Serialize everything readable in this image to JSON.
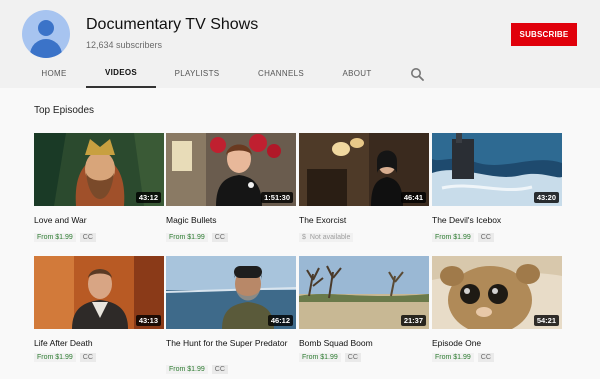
{
  "channel": {
    "name": "Documentary TV Shows",
    "subscribers": "12,634 subscribers"
  },
  "subscribe_label": "SUBSCRIBE",
  "tabs": [
    "HOME",
    "VIDEOS",
    "PLAYLISTS",
    "CHANNELS",
    "ABOUT"
  ],
  "active_tab": "VIDEOS",
  "section_title": "Top Episodes",
  "episodes": [
    {
      "title": "Love and War",
      "duration": "43:12",
      "price": "From $1.99",
      "cc": "CC"
    },
    {
      "title": "Magic Bullets",
      "duration": "1:51:30",
      "price": "From $1.99",
      "cc": "CC"
    },
    {
      "title": "The Exorcist",
      "duration": "46:41",
      "price_symbol": "$",
      "availability": "Not available"
    },
    {
      "title": "The Devil's Icebox",
      "duration": "43:20",
      "price": "From $1.99",
      "cc": "CC"
    },
    {
      "title": "Life After Death",
      "duration": "43:13",
      "price": "From $1.99",
      "cc": "CC"
    },
    {
      "title": "The Hunt for the Super Predator",
      "duration": "46:12",
      "price": "From $1.99",
      "cc": "CC"
    },
    {
      "title": "Bomb Squad Boom",
      "duration": "21:37",
      "price": "From $1.99",
      "cc": "CC"
    },
    {
      "title": "Episode One",
      "duration": "54:21",
      "price": "From $1.99",
      "cc": "CC"
    }
  ],
  "colors": {
    "subscribe": "#e0000b",
    "price": "#2e7d32",
    "header_bg": "#f1f1f1"
  }
}
